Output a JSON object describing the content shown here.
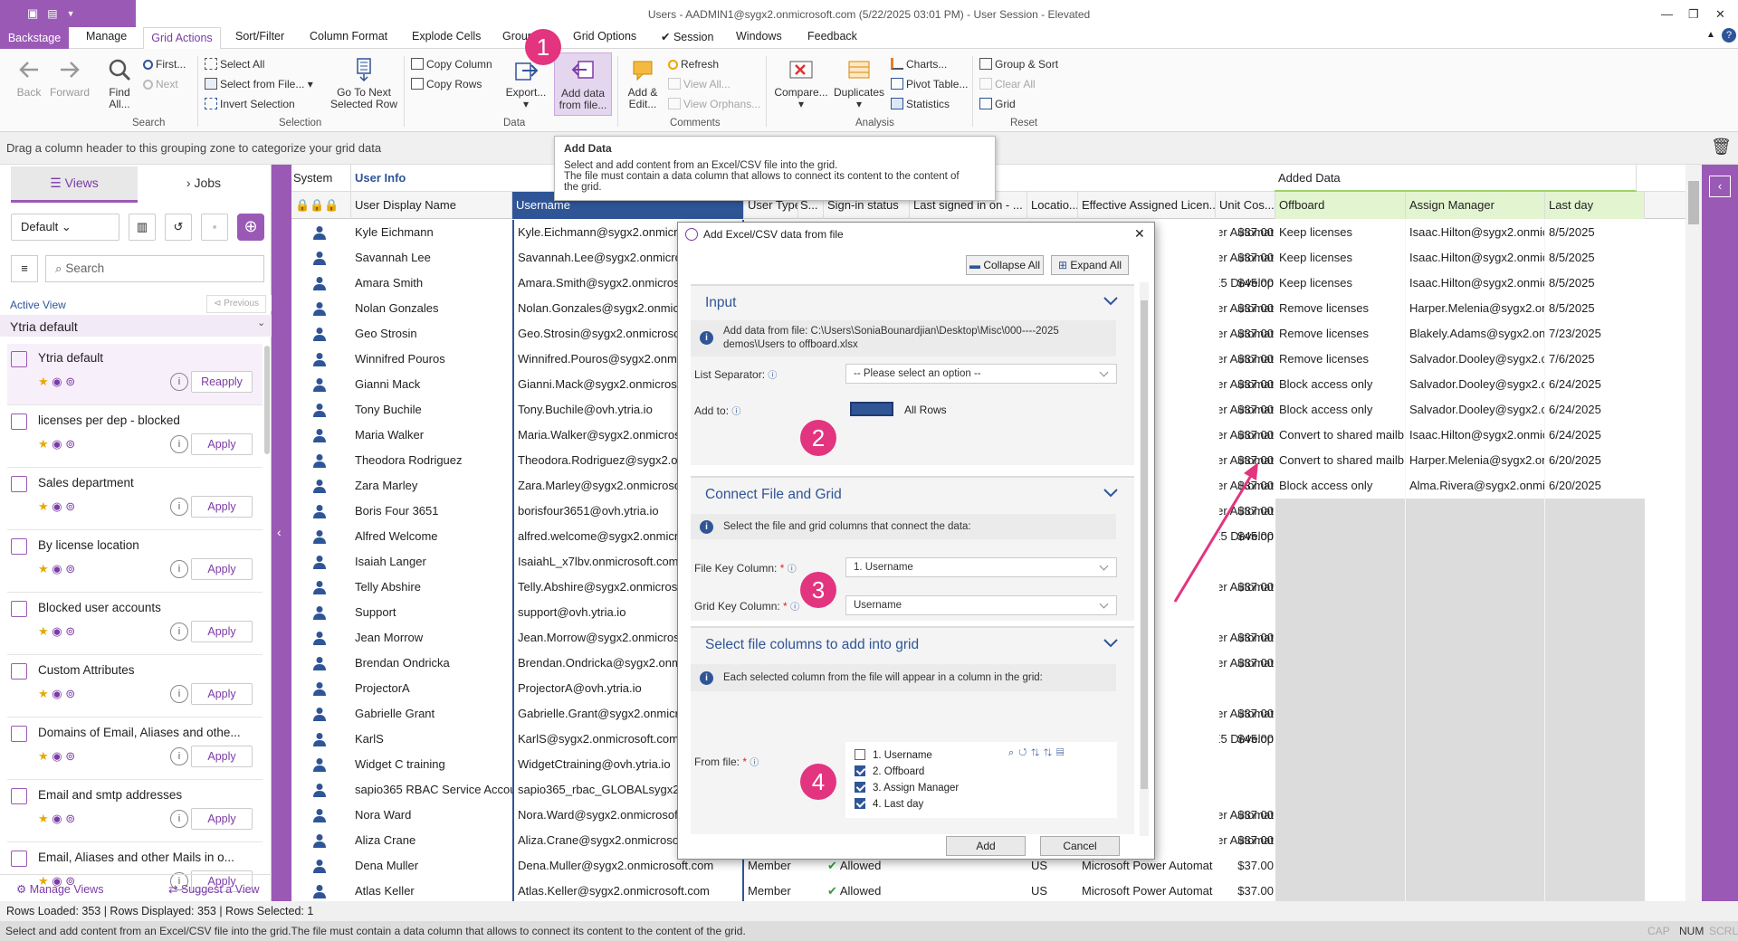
{
  "window": {
    "title": "Users - AADMIN1@sygx2.onmicrosoft.com (5/22/2025 03:01 PM) - User Session - Elevated"
  },
  "tabs": [
    "Backstage",
    "Manage",
    "Grid Actions",
    "Sort/Filter",
    "Column Format",
    "Explode Cells",
    "Group",
    "Grid Options",
    "Session",
    "Windows",
    "Feedback"
  ],
  "ribbon": {
    "back": "Back",
    "forward": "Forward",
    "find_all": "Find All...",
    "first": "First...",
    "next": "Next",
    "search_group": "Search",
    "select_all": "Select All",
    "select_from_file": "Select from File...",
    "invert": "Invert Selection",
    "go_to_next": "Go To Next Selected Row",
    "selection_group": "Selection",
    "copy_column": "Copy Column",
    "copy_rows": "Copy Rows",
    "export": "Export...",
    "add_data": "Add data from file...",
    "data_group": "Data",
    "add_edit": "Add & Edit...",
    "refresh": "Refresh",
    "view_all": "View All...",
    "view_orphans": "View Orphans...",
    "comments_group": "Comments",
    "compare": "Compare...",
    "duplicates": "Duplicates",
    "charts": "Charts...",
    "pivot": "Pivot Table...",
    "statistics": "Statistics",
    "analysis_group": "Analysis",
    "group_sort": "Group & Sort",
    "clear_all": "Clear All",
    "grid": "Grid",
    "reset_group": "Reset"
  },
  "groupzone": "Drag a column header to this grouping zone to categorize your grid data",
  "tooltip": {
    "title": "Add Data",
    "line1": "Select and add content from an Excel/CSV file into the grid.",
    "line2": "The file must contain a data column that allows to connect its content to the content of",
    "line3": "the grid."
  },
  "left": {
    "tab_views": "Views",
    "tab_jobs": "Jobs",
    "default": "Default",
    "search": "Search",
    "active_view": "Active View",
    "previous": "Previous",
    "current": "Ytria default",
    "items": [
      {
        "name": "Ytria default",
        "btn": "Reapply"
      },
      {
        "name": "licenses per dep - blocked",
        "btn": "Apply"
      },
      {
        "name": "Sales department",
        "btn": "Apply"
      },
      {
        "name": "By license location",
        "btn": "Apply"
      },
      {
        "name": "Blocked user accounts",
        "btn": "Apply"
      },
      {
        "name": "Custom Attributes",
        "btn": "Apply"
      },
      {
        "name": "Domains of Email, Aliases and othe...",
        "btn": "Apply"
      },
      {
        "name": "Email and smtp addresses",
        "btn": "Apply"
      },
      {
        "name": "Email, Aliases and other Mails in o...",
        "btn": "Apply"
      }
    ],
    "manage": "Manage Views",
    "suggest": "Suggest a View"
  },
  "grid": {
    "group_system": "System",
    "group_userinfo": "User Info",
    "group_added": "Added Data",
    "headers": {
      "display": "User Display Name",
      "username": "Username",
      "usertype": "User Type",
      "s": "S...",
      "signin": "Sign-in status",
      "lastsigned": "Last signed in on - ...",
      "location": "Locatio...",
      "license": "Effective Assigned Licen...",
      "unitcost": "Unit Cos...",
      "offboard": "Offboard",
      "assign": "Assign Manager",
      "lastday": "Last day"
    },
    "rows": [
      {
        "n": "Kyle Eichmann",
        "u": "Kyle.Eichmann@sygx2.onmicros",
        "l": "er Automat",
        "c": "$37.00",
        "o": "Keep licenses",
        "m": "Isaac.Hilton@sygx2.onmic",
        "d": "8/5/2025"
      },
      {
        "n": "Savannah Lee",
        "u": "Savannah.Lee@sygx2.onmicroso",
        "l": "er Automat",
        "c": "$37.00",
        "o": "Keep licenses",
        "m": "Isaac.Hilton@sygx2.onmic",
        "d": "8/5/2025"
      },
      {
        "n": "Amara Smith",
        "u": "Amara.Smith@sygx2.onmicroso",
        "l": "E5 Develop",
        "c": "$45.00",
        "o": "Keep licenses",
        "m": "Isaac.Hilton@sygx2.onmic",
        "d": "8/5/2025"
      },
      {
        "n": "Nolan Gonzales",
        "u": "Nolan.Gonzales@sygx2.onmicro",
        "l": "er Automat",
        "c": "$37.00",
        "o": "Remove licenses",
        "m": "Harper.Melenia@sygx2.onr",
        "d": "8/5/2025"
      },
      {
        "n": "Geo Strosin",
        "u": "Geo.Strosin@sygx2.onmicrosof",
        "l": "er Automat",
        "c": "$37.00",
        "o": "Remove licenses",
        "m": "Blakely.Adams@sygx2.onr",
        "d": "7/23/2025"
      },
      {
        "n": "Winnifred Pouros",
        "u": "Winnifred.Pouros@sygx2.onmic",
        "l": "er Automat",
        "c": "$37.00",
        "o": "Remove licenses",
        "m": "Salvador.Dooley@sygx2.c",
        "d": "7/6/2025"
      },
      {
        "n": "Gianni Mack",
        "u": "Gianni.Mack@sygx2.onmicrosof",
        "l": "er Automat",
        "c": "$37.00",
        "o": "Block access only",
        "m": "Salvador.Dooley@sygx2.c",
        "d": "6/24/2025"
      },
      {
        "n": "Tony Buchile",
        "u": "Tony.Buchile@ovh.ytria.io",
        "l": "er Automat",
        "c": "$37.00",
        "o": "Block access only",
        "m": "Salvador.Dooley@sygx2.c",
        "d": "6/24/2025"
      },
      {
        "n": "Maria Walker",
        "u": "Maria.Walker@sygx2.onmicrosof",
        "l": "er Automat",
        "c": "$37.00",
        "o": "Convert to shared mailb",
        "m": "Isaac.Hilton@sygx2.onmic",
        "d": "6/24/2025"
      },
      {
        "n": "Theodora Rodriguez",
        "u": "Theodora.Rodriguez@sygx2.on",
        "l": "er Automat",
        "c": "$37.00",
        "o": "Convert to shared mailb",
        "m": "Harper.Melenia@sygx2.or",
        "d": "6/20/2025"
      },
      {
        "n": "Zara Marley",
        "u": "Zara.Marley@sygx2.onmicrosof",
        "l": "er Automat",
        "c": "$37.00",
        "o": "Block access only",
        "m": "Alma.Rivera@sygx2.onmi",
        "d": "6/20/2025"
      },
      {
        "n": "Boris Four 3651",
        "u": "borisfour3651@ovh.ytria.io",
        "l": "er Automat",
        "c": "$37.00",
        "o": "",
        "m": "",
        "d": ""
      },
      {
        "n": "Alfred Welcome",
        "u": "alfred.welcome@sygx2.onmicro",
        "l": "E5 Develop",
        "c": "$45.00",
        "o": "",
        "m": "",
        "d": ""
      },
      {
        "n": "Isaiah Langer",
        "u": "IsaiahL_x7lbv.onmicrosoft.com#",
        "l": "",
        "c": "",
        "o": "",
        "m": "",
        "d": ""
      },
      {
        "n": "Telly Abshire",
        "u": "Telly.Abshire@sygx2.onmicroso",
        "l": "er Automat",
        "c": "$37.00",
        "o": "",
        "m": "",
        "d": ""
      },
      {
        "n": "Support",
        "u": "support@ovh.ytria.io",
        "l": "",
        "c": "",
        "o": "",
        "m": "",
        "d": ""
      },
      {
        "n": "Jean Morrow",
        "u": "Jean.Morrow@sygx2.onmicroso",
        "l": "er Automat",
        "c": "$37.00",
        "o": "",
        "m": "",
        "d": ""
      },
      {
        "n": "Brendan Ondricka",
        "u": "Brendan.Ondricka@sygx2.onmi",
        "l": "er Automat",
        "c": "$37.00",
        "o": "",
        "m": "",
        "d": ""
      },
      {
        "n": "ProjectorA",
        "u": "ProjectorA@ovh.ytria.io",
        "l": "",
        "c": "",
        "o": "",
        "m": "",
        "d": ""
      },
      {
        "n": "Gabrielle Grant",
        "u": "Gabrielle.Grant@sygx2.onmicro",
        "l": "er Automat",
        "c": "$37.00",
        "o": "",
        "m": "",
        "d": ""
      },
      {
        "n": "KarlS",
        "u": "KarlS@sygx2.onmicrosoft.com",
        "l": "E5 Develop",
        "c": "$45.00",
        "o": "",
        "m": "",
        "d": ""
      },
      {
        "n": "Widget C training",
        "u": "WidgetCtraining@ovh.ytria.io",
        "l": "",
        "c": "",
        "o": "",
        "m": "",
        "d": ""
      },
      {
        "n": "sapio365 RBAC Service Accou",
        "u": "sapio365_rbac_GLOBALsygx2on",
        "l": "",
        "c": "",
        "o": "",
        "m": "",
        "d": ""
      },
      {
        "n": "Nora Ward",
        "u": "Nora.Ward@sygx2.onmicrosoft",
        "l": "er Automat",
        "c": "$37.00",
        "o": "",
        "m": "",
        "d": ""
      },
      {
        "n": "Aliza Crane",
        "u": "Aliza.Crane@sygx2.onmicrosoft",
        "l": "er Automat",
        "c": "$37.00",
        "o": "",
        "m": "",
        "d": ""
      },
      {
        "n": "Dena Muller",
        "u": "Dena.Muller@sygx2.onmicrosoft.com",
        "l": "Microsoft Power Automat",
        "c": "$37.00",
        "o": "",
        "m": "",
        "d": "",
        "t": "Member",
        "s": "Allowed",
        "loc": "US"
      },
      {
        "n": "Atlas Keller",
        "u": "Atlas.Keller@sygx2.onmicrosoft.com",
        "l": "Microsoft Power Automat",
        "c": "$37.00",
        "o": "",
        "m": "",
        "d": "",
        "t": "Member",
        "s": "Allowed",
        "loc": "US"
      }
    ]
  },
  "dialog": {
    "title": "Add Excel/CSV data from file",
    "collapse": "Collapse All",
    "expand": "Expand All",
    "input": "Input",
    "input_info1": "Add data from file: C:\\Users\\SoniaBounardjian\\Desktop\\Misc\\000----2025",
    "input_info2": "demos\\Users to offboard.xlsx",
    "list_sep": "List Separator:",
    "list_sep_val": "-- Please select an option --",
    "add_to": "Add to:",
    "add_to_val": "All Rows",
    "connect": "Connect File and Grid",
    "connect_info": "Select the file and grid columns that connect the data:",
    "file_key": "File Key Column:",
    "file_key_val": "1. Username",
    "grid_key": "Grid Key Column:",
    "grid_key_val": "Username",
    "select": "Select file columns to add into grid",
    "select_info": "Each selected column from the file will appear in a column in the grid:",
    "from_file": "From file:",
    "cols": [
      "1. Username",
      "2. Offboard",
      "3. Assign Manager",
      "4. Last day"
    ],
    "add": "Add",
    "cancel": "Cancel"
  },
  "status": "Rows Loaded: 353 | Rows Displayed: 353 | Rows Selected: 1",
  "tip": "Select and add content from an Excel/CSV file into the grid.The file must contain a data column that allows to connect its content to the content of the grid.",
  "indicators": [
    "CAP",
    "NUM",
    "SCRL"
  ],
  "badges": [
    "1",
    "2",
    "3",
    "4"
  ],
  "colors": {
    "accent": "#9b59b6",
    "badge": "#e3347f",
    "link": "#2f5597",
    "added_header": "#e2f5d0"
  }
}
